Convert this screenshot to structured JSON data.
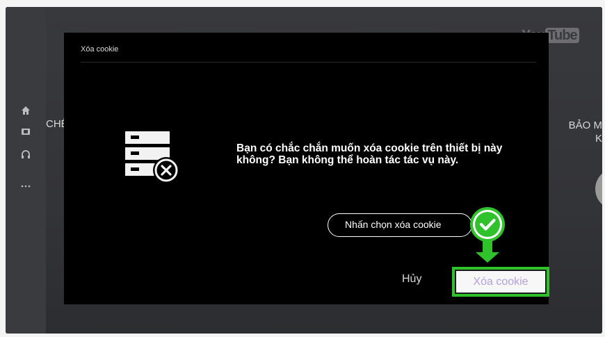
{
  "background": {
    "youtube_logo_you": "You",
    "youtube_logo_tube": "Tube",
    "left_partial_text": "CHẾ",
    "right_partial_text_1": "BẢO M",
    "right_partial_text_2": "K",
    "rail_icons": [
      "home-icon",
      "tv-icon",
      "headphones-icon",
      "more-dots-icon"
    ]
  },
  "dialog": {
    "title": "Xóa cookie",
    "message": "Bạn có chắc chắn muốn xóa cookie trên thiết bị này không? Bạn không thể hoàn tác tác vụ này.",
    "icon": "server-delete-icon",
    "cancel_label": "Hủy",
    "confirm_label": "Xóa cookie"
  },
  "annotation": {
    "tooltip_text": "Nhấn chọn xóa cookie",
    "marker_icon": "check-icon",
    "marker_color": "#2fc22b"
  },
  "colors": {
    "accent_green": "#2fc22b",
    "confirm_text": "#b3a0d9",
    "dialog_bg": "#000000"
  }
}
